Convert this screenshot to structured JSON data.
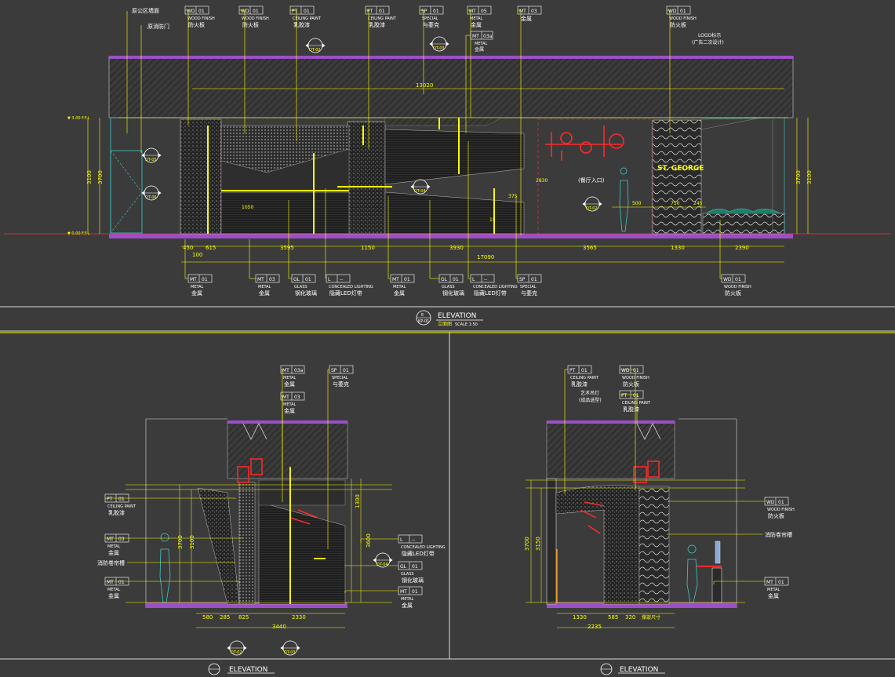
{
  "top_elevation": {
    "title": "ELEVATION",
    "tag_line1": "E",
    "tag_line2": "KP-01",
    "subtitle": "立面图",
    "scale": "SCALE  1:50",
    "overall_width_top": "13020",
    "overall_width_bottom": "17090",
    "heights_left": [
      "3100",
      "3700"
    ],
    "heights_right": [
      "3700",
      "3100"
    ],
    "bottom_dims": [
      "450",
      "615",
      "3595",
      "1150",
      "3930",
      "3565",
      "1330",
      "2390"
    ],
    "sub_dim": "100",
    "sign_text": "ST. GEORGE",
    "entrance_text": "(餐厅入口)",
    "top_callouts": [
      {
        "code": "WD",
        "num": "01",
        "en": "WOOD FINISH",
        "cn": "防火板"
      },
      {
        "code": "WD",
        "num": "01",
        "en": "WOOD FINISH",
        "cn": "防火板"
      },
      {
        "code": "PT",
        "num": "01",
        "en": "CEILING  PAINT",
        "cn": "乳胶漆"
      },
      {
        "code": "PT",
        "num": "01",
        "en": "CEILING  PAINT",
        "cn": "乳胶漆"
      },
      {
        "code": "SP",
        "num": "01",
        "en": "SPECIAL",
        "cn": "与萎克"
      },
      {
        "code": "MT",
        "num": "05",
        "en": "METAL",
        "cn": "金属"
      },
      {
        "code": "MT",
        "num": "03",
        "en": "",
        "cn": "金属"
      },
      {
        "code": "WD",
        "num": "01",
        "en": "WOOD FINISH",
        "cn": "防火板"
      }
    ],
    "mt03a": {
      "code": "MT",
      "num": "03a",
      "en": "METAL",
      "cn": "金属"
    },
    "notes_left": [
      "原公区墙面",
      "原消防门"
    ],
    "logo_note": [
      "LOGO标示",
      "(广告二次设计)"
    ],
    "bottom_callouts": [
      {
        "code": "MT",
        "num": "01",
        "en": "METAL",
        "cn": "金属"
      },
      {
        "code": "MT",
        "num": "03",
        "en": "METAL",
        "cn": "金属"
      },
      {
        "code": "GL",
        "num": "01",
        "en": "GLASS",
        "cn": "钢化玻璃"
      },
      {
        "code": "L",
        "num": "--",
        "en": "CONCEALED LIGHTING",
        "cn": "隐藏LED灯带"
      },
      {
        "code": "MT",
        "num": "01",
        "en": "METAL",
        "cn": "金属"
      },
      {
        "code": "GL",
        "num": "01",
        "en": "GLASS",
        "cn": "钢化玻璃"
      },
      {
        "code": "L",
        "num": "--",
        "en": "CONCEALED LIGHTING",
        "cn": "隐藏LED灯带"
      },
      {
        "code": "SP",
        "num": "01",
        "en": "SPECIAL",
        "cn": "与萎克"
      },
      {
        "code": "WD",
        "num": "01",
        "en": "WOOD FINISH",
        "cn": "防火板"
      }
    ],
    "detail_tags": [
      "DT-02",
      "DT-03",
      "DT-05",
      "DT-06",
      "DT-04",
      "DT-02"
    ]
  },
  "bottom_left_elevation": {
    "title": "ELEVATION",
    "heights": [
      "3700",
      "3100"
    ],
    "right_dims": [
      "1300",
      "3600"
    ],
    "bottom_dims": [
      "580",
      "285",
      "825",
      "2330"
    ],
    "total": "3440",
    "fire_note": "消防卷帘槽",
    "callouts": [
      {
        "code": "MT",
        "num": "03a",
        "en": "METAL",
        "cn": "金属"
      },
      {
        "code": "SP",
        "num": "01",
        "en": "SPECIAL",
        "cn": "与萎克"
      },
      {
        "code": "MT",
        "num": "03",
        "en": "METAL",
        "cn": "金属"
      },
      {
        "code": "PT",
        "num": "01",
        "en": "CEILING  PAINT",
        "cn": "乳胶漆"
      },
      {
        "code": "MT",
        "num": "03",
        "en": "METAL",
        "cn": "金属"
      },
      {
        "code": "L",
        "num": "--",
        "en": "CONCEALED LIGHTING",
        "cn": "隐藏LED灯带"
      },
      {
        "code": "GL",
        "num": "01",
        "en": "GLASS",
        "cn": "钢化玻璃"
      },
      {
        "code": "MT",
        "num": "01",
        "en": "METAL",
        "cn": "金属"
      },
      {
        "code": "MT",
        "num": "01",
        "en": "METAL",
        "cn": "金属"
      }
    ],
    "detail_tags": [
      "DT-02",
      "DT-03",
      "DT-04"
    ]
  },
  "bottom_right_elevation": {
    "title": "ELEVATION",
    "heights": [
      "3700",
      "3150"
    ],
    "bottom_dims": [
      "1330",
      "585",
      "320"
    ],
    "total": "2235",
    "end_note": "撑嵌尺寸",
    "fire_note": "消防卷帘槽",
    "art_note": [
      "艺术吊灯",
      "(成品选型)"
    ],
    "callouts": [
      {
        "code": "PT",
        "num": "01",
        "en": "CEILING  PAINT",
        "cn": "乳胶漆"
      },
      {
        "code": "WD",
        "num": "01",
        "en": "WOOD FINISH",
        "cn": "防火板"
      },
      {
        "code": "PT",
        "num": "01",
        "en": "CEILING  PAINT",
        "cn": "乳胶漆"
      },
      {
        "code": "WD",
        "num": "01",
        "en": "WOOD FINISH",
        "cn": "防火板"
      },
      {
        "code": "MT",
        "num": "01",
        "en": "METAL",
        "cn": "金属"
      }
    ]
  },
  "colors": {
    "background": "#3b3b3b",
    "annotation": "#ffff00",
    "text": "#ffffff",
    "floor_band": "#9b4fc8",
    "red": "#ff2b2b",
    "cyan": "#1ec8c8",
    "orange": "#ff9a00",
    "green": "#3cd23c",
    "magenta": "#e040e0"
  }
}
